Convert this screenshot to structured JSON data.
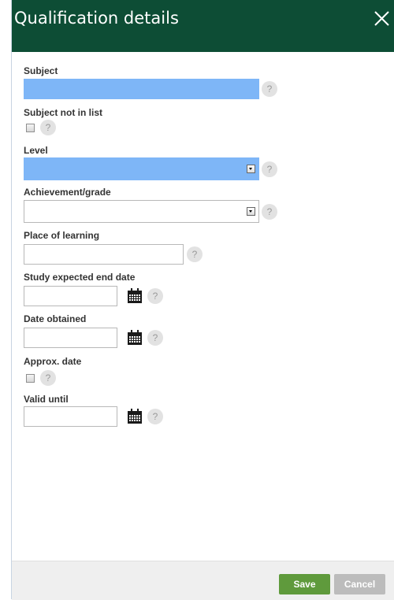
{
  "dialog": {
    "title": "Qualification details"
  },
  "fields": {
    "subject": {
      "label": "Subject",
      "value": ""
    },
    "subject_not_in_list": {
      "label": "Subject not in list",
      "checked": false
    },
    "level": {
      "label": "Level",
      "value": ""
    },
    "achievement_grade": {
      "label": "Achievement/grade",
      "value": ""
    },
    "place_of_learning": {
      "label": "Place of learning",
      "value": ""
    },
    "study_expected_end_date": {
      "label": "Study expected end date",
      "value": ""
    },
    "date_obtained": {
      "label": "Date obtained",
      "value": ""
    },
    "approx_date": {
      "label": "Approx. date",
      "checked": false
    },
    "valid_until": {
      "label": "Valid until",
      "value": ""
    }
  },
  "help_glyph": "?",
  "footer": {
    "save_label": "Save",
    "cancel_label": "Cancel"
  },
  "colors": {
    "header": "#0d4d35",
    "highlight": "#7eb6f7",
    "save": "#5f9a3c",
    "cancel": "#bcbcbc"
  }
}
